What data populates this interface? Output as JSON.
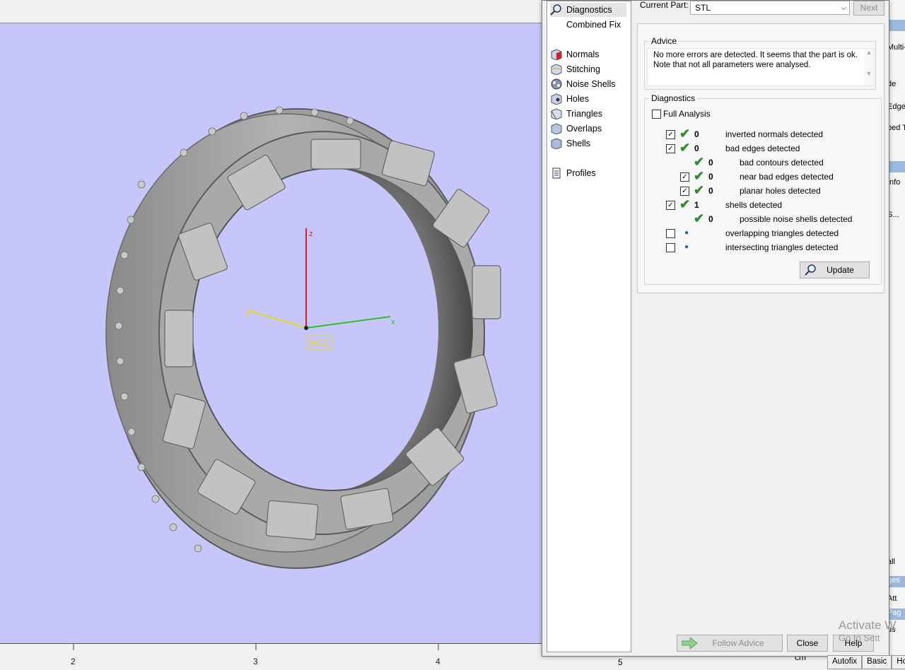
{
  "viewport": {
    "axis_labels": {
      "z": "z",
      "y": "y",
      "x": "x"
    },
    "wcs_label": "WCS",
    "ruler": {
      "ticks": [
        "2",
        "3",
        "4",
        "5"
      ],
      "unit": "cm"
    },
    "background_color": "#c6c6fb"
  },
  "nav": {
    "items": [
      {
        "label": "Diagnostics",
        "icon": "magnifier-icon",
        "selected": true
      },
      {
        "label": "Combined Fix",
        "icon": "none"
      },
      {
        "label": "Normals",
        "icon": "normals-cube-icon"
      },
      {
        "label": "Stitching",
        "icon": "stitching-cube-icon"
      },
      {
        "label": "Noise Shells",
        "icon": "noise-shells-icon"
      },
      {
        "label": "Holes",
        "icon": "holes-cube-icon"
      },
      {
        "label": "Triangles",
        "icon": "triangles-cube-icon"
      },
      {
        "label": "Overlaps",
        "icon": "overlaps-cube-icon"
      },
      {
        "label": "Shells",
        "icon": "shells-cube-icon"
      },
      {
        "label": "Profiles",
        "icon": "document-icon"
      }
    ]
  },
  "header": {
    "current_part_label": "Current Part:",
    "current_part_value": "STL",
    "next_label": "Next"
  },
  "advice": {
    "title": "Advice",
    "text_line1": "No more errors are detected. It seems that the part is ok.",
    "text_line2": "Note that not all parameters were analysed."
  },
  "diagnostics": {
    "title": "Diagnostics",
    "full_analysis_label": "Full Analysis",
    "rows": [
      {
        "checked": true,
        "status": "ok",
        "count": "0",
        "label": "inverted normals detected",
        "indent": 0
      },
      {
        "checked": true,
        "status": "ok",
        "count": "0",
        "label": "bad edges detected",
        "indent": 0
      },
      {
        "checked": null,
        "status": "ok",
        "count": "0",
        "label": "bad contours detected",
        "indent": 1
      },
      {
        "checked": true,
        "status": "ok",
        "count": "0",
        "label": "near bad edges detected",
        "indent": 1
      },
      {
        "checked": true,
        "status": "ok",
        "count": "0",
        "label": "planar holes detected",
        "indent": 1
      },
      {
        "checked": true,
        "status": "ok",
        "count": "1",
        "label": "shells detected",
        "indent": 0
      },
      {
        "checked": null,
        "status": "ok",
        "count": "0",
        "label": "possible noise shells detected",
        "indent": 1
      },
      {
        "checked": false,
        "status": "dot",
        "count": "",
        "label": "overlapping triangles detected",
        "indent": 0
      },
      {
        "checked": false,
        "status": "dot",
        "count": "",
        "label": "intersecting triangles detected",
        "indent": 0
      }
    ],
    "update_label": "Update"
  },
  "footer": {
    "follow_advice_label": "Follow Advice",
    "close_label": "Close",
    "help_label": "Help"
  },
  "right_panel": {
    "fragments": [
      "Multi-",
      "de",
      "Edge",
      "ped Tr",
      "Info",
      "S...",
      "all",
      "ges",
      "Att",
      "Pag",
      "us"
    ],
    "tabs": [
      "Autofix",
      "Basic",
      "Hol"
    ]
  },
  "watermark": {
    "line1": "Activate W",
    "line2": "Go to Sett"
  }
}
